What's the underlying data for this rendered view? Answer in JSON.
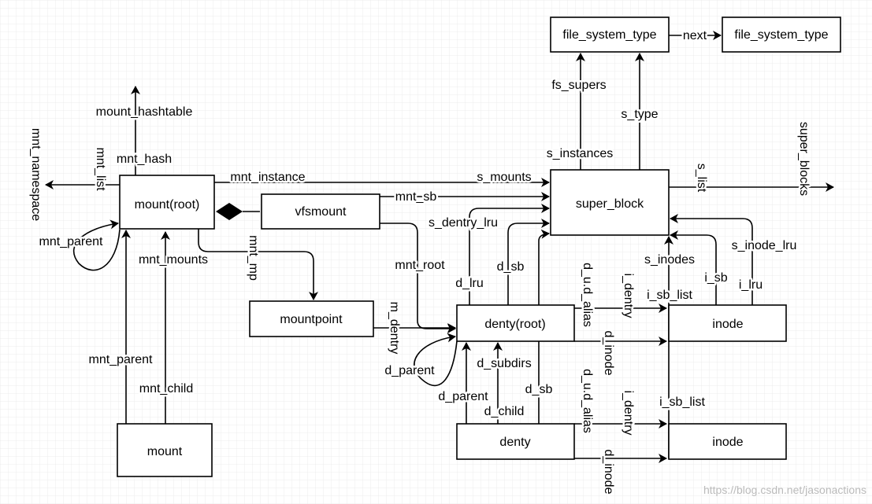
{
  "boxes": {
    "mount_root": "mount(root)",
    "vfsmount": "vfsmount",
    "mountpoint": "mountpoint",
    "denty_root": "denty(root)",
    "denty": "denty",
    "super_block": "super_block",
    "fst1": "file_system_type",
    "fst2": "file_system_type",
    "inode1": "inode",
    "inode2": "inode",
    "mount": "mount"
  },
  "labels": {
    "mount_hashtable": "mount_hashtable",
    "mnt_hash": "mnt_hash",
    "mnt_list": "mnt_list",
    "mnt_namespace": "mnt_namespace",
    "mnt_instance": "mnt_instance",
    "s_mounts": "s_mounts",
    "mnt_sb": "mnt_sb",
    "mnt_root": "mnt_root",
    "mnt_mp": "mnt_mp",
    "mnt_parent_self": "mnt_parent",
    "mnt_mounts": "mnt_mounts",
    "mnt_parent": "mnt_parent",
    "mnt_child": "mnt_child",
    "m_dentry": "m_dentry",
    "d_parent_self": "d_parent",
    "s_dentry_lru": "s_dentry_lru",
    "d_lru": "d_lru",
    "d_sb_root": "d_sb",
    "d_sb": "d_sb",
    "d_parent": "d_parent",
    "d_subdirs": "d_subdirs",
    "d_child": "d_child",
    "d_u_d_alias_1": "d_u.d_alias",
    "i_dentry_1": "i_dentry",
    "d_inode_1": "d_inode",
    "d_u_d_alias_2": "d_u.d_alias",
    "i_dentry_2": "i_dentry",
    "d_inode_2": "d_inode",
    "s_inodes": "s_inodes",
    "i_sb_list_1": "i_sb_list",
    "i_sb_list_2": "i_sb_list",
    "i_sb": "i_sb",
    "s_inode_lru": "s_inode_lru",
    "i_lru": "i_lru",
    "s_list": "s_list",
    "super_blocks": "super_blocks",
    "fs_supers": "fs_supers",
    "s_instances": "s_instances",
    "s_type": "s_type",
    "next": "next"
  },
  "watermark": "https://blog.csdn.net/jasonactions"
}
